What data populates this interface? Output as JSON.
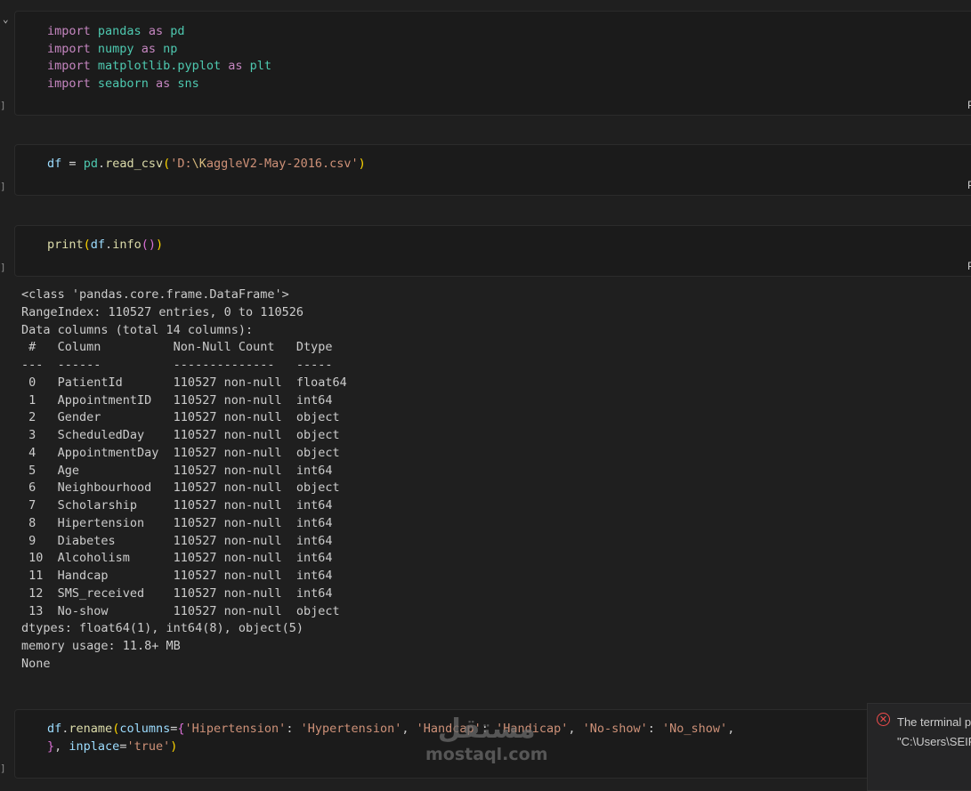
{
  "cells": [
    {
      "lang": "Py"
    },
    {
      "lang": "Py"
    },
    {
      "lang": "Py"
    },
    {
      "lang": ""
    }
  ],
  "cell_bracket": "]",
  "collapse_icon": "chevron-down-icon",
  "output": {
    "lines": [
      "<class 'pandas.core.frame.DataFrame'>",
      "RangeIndex: 110527 entries, 0 to 110526",
      "Data columns (total 14 columns):",
      " #   Column          Non-Null Count   Dtype  ",
      "---  ------          --------------   -----  ",
      " 0   PatientId       110527 non-null  float64",
      " 1   AppointmentID   110527 non-null  int64  ",
      " 2   Gender          110527 non-null  object ",
      " 3   ScheduledDay    110527 non-null  object ",
      " 4   AppointmentDay  110527 non-null  object ",
      " 5   Age             110527 non-null  int64  ",
      " 6   Neighbourhood   110527 non-null  object ",
      " 7   Scholarship     110527 non-null  int64  ",
      " 8   Hipertension    110527 non-null  int64  ",
      " 9   Diabetes        110527 non-null  int64  ",
      " 10  Alcoholism      110527 non-null  int64  ",
      " 11  Handcap         110527 non-null  int64  ",
      " 12  SMS_received    110527 non-null  int64  ",
      " 13  No-show         110527 non-null  object ",
      "dtypes: float64(1), int64(8), object(5)",
      "memory usage: 11.8+ MB",
      "None"
    ]
  },
  "toast": {
    "icon": "error-circle-icon",
    "title": "The terminal p",
    "path": "\"C:\\Users\\SEIF"
  },
  "watermark": {
    "arabic": "مستقل",
    "latin": "mostaql.com"
  },
  "colors": {
    "background": "#1f1f1f",
    "cell_bg": "#1b1b1b",
    "keyword": "#c586c0",
    "module": "#4ec9b0",
    "string": "#ce9178",
    "function": "#dcdcaa",
    "error": "#f14c4c"
  }
}
